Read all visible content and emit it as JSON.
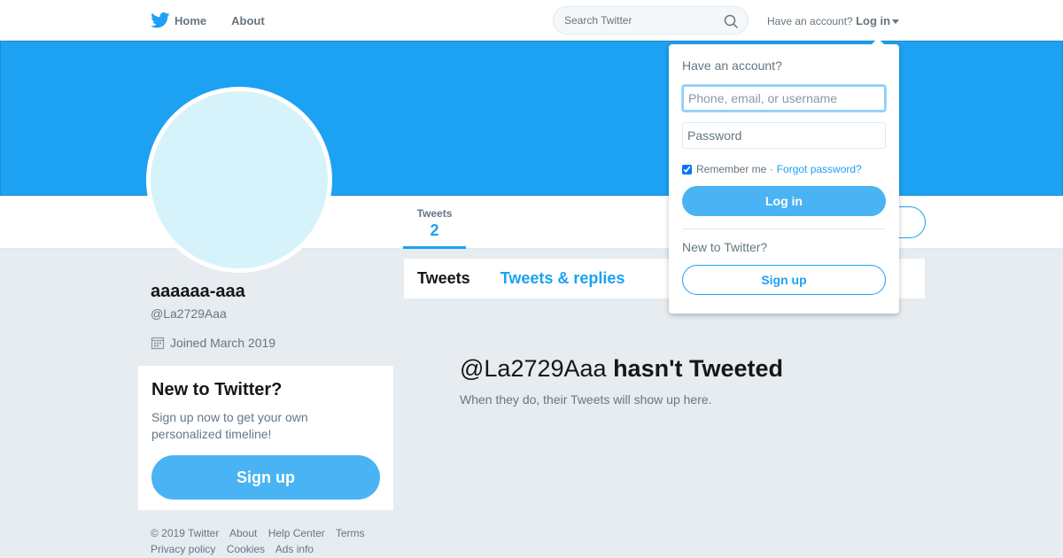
{
  "nav": {
    "home": "Home",
    "about": "About",
    "search_placeholder": "Search Twitter",
    "account_prompt": "Have an account?",
    "login_label": "Log in"
  },
  "profile": {
    "name": "aaaaaa-aaa",
    "handle": "@La2729Aaa",
    "joined": "Joined March 2019",
    "stats": {
      "tweets_label": "Tweets",
      "tweets_count": "2"
    },
    "colors": {
      "banner": "#1da1f2",
      "avatar": "#d6f3fb",
      "accent": "#1da1f2"
    }
  },
  "signup_card": {
    "title": "New to Twitter?",
    "text": "Sign up now to get your own personalized timeline!",
    "button": "Sign up"
  },
  "tabs": [
    {
      "label": "Tweets",
      "active": true
    },
    {
      "label": "Tweets & replies",
      "active": false
    }
  ],
  "timeline": {
    "empty_handle": "@La2729Aaa",
    "empty_title": "hasn't Tweeted",
    "empty_sub": "When they do, their Tweets will show up here."
  },
  "footer": [
    "© 2019 Twitter",
    "About",
    "Help Center",
    "Terms",
    "Privacy policy",
    "Cookies",
    "Ads info"
  ],
  "login_dropdown": {
    "title": "Have an account?",
    "username_placeholder": "Phone, email, or username",
    "password_placeholder": "Password",
    "remember_label": "Remember me ·",
    "remember_checked": true,
    "forgot": "Forgot password?",
    "login_button": "Log in",
    "new_prompt": "New to Twitter?",
    "signup_button": "Sign up"
  }
}
